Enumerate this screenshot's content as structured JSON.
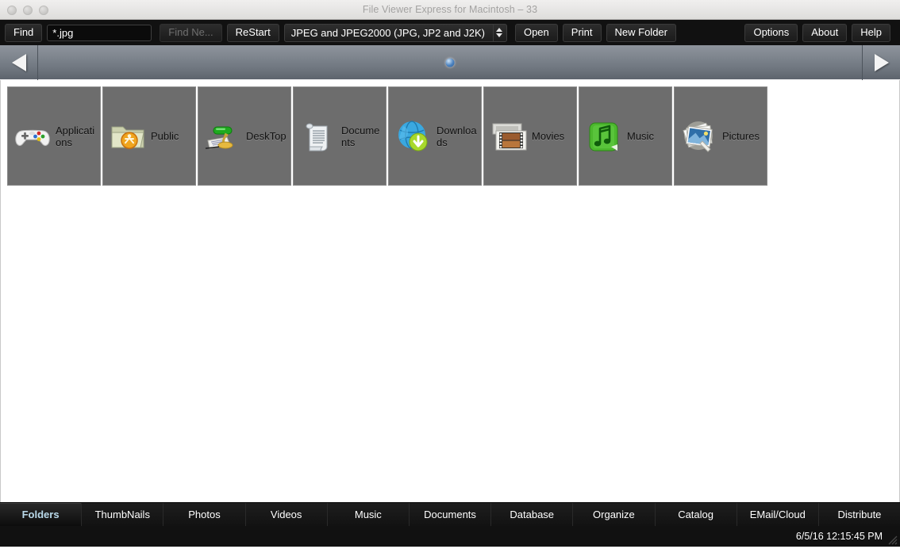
{
  "window": {
    "title": "File Viewer Express for Macintosh – 33",
    "traffic_lights": [
      "close",
      "minimize",
      "zoom"
    ]
  },
  "toolbar": {
    "find_label": "Find",
    "find_value": "*.jpg",
    "find_placeholder": "*.jpg",
    "find_next_label": "Find Ne...",
    "find_next_disabled": true,
    "restart_label": "ReStart",
    "filetype_selected": "JPEG and JPEG2000 (JPG, JP2 and J2K)",
    "filetype_options": [
      "JPEG and JPEG2000 (JPG, JP2 and J2K)"
    ],
    "open_label": "Open",
    "print_label": "Print",
    "new_folder_label": "New Folder",
    "options_label": "Options",
    "about_label": "About",
    "help_label": "Help"
  },
  "navbar": {
    "prev_icon": "left-triangle-icon",
    "next_icon": "right-triangle-icon",
    "page_marker": "page-position-dot"
  },
  "tiles": [
    {
      "label": "Applications",
      "icon": "game-controller-icon"
    },
    {
      "label": "Public",
      "icon": "public-folder-icon"
    },
    {
      "label": "DeskTop",
      "icon": "desk-lamp-icon"
    },
    {
      "label": "Documents",
      "icon": "scroll-document-icon"
    },
    {
      "label": "Downloads",
      "icon": "globe-download-icon"
    },
    {
      "label": "Movies",
      "icon": "film-strip-icon"
    },
    {
      "label": "Music",
      "icon": "music-note-icon"
    },
    {
      "label": "Pictures",
      "icon": "photos-icon"
    }
  ],
  "tabs": [
    {
      "label": "Folders",
      "active": true
    },
    {
      "label": "ThumbNails",
      "active": false
    },
    {
      "label": "Photos",
      "active": false
    },
    {
      "label": "Videos",
      "active": false
    },
    {
      "label": "Music",
      "active": false
    },
    {
      "label": "Documents",
      "active": false
    },
    {
      "label": "Database",
      "active": false
    },
    {
      "label": "Organize",
      "active": false
    },
    {
      "label": "Catalog",
      "active": false
    },
    {
      "label": "EMail/Cloud",
      "active": false
    },
    {
      "label": "Distribute",
      "active": false
    }
  ],
  "statusbar": {
    "timestamp": "6/5/16 12:15:45 PM",
    "resize_grip": "resize-grip-icon"
  },
  "colors": {
    "toolbar_bg": "#111111",
    "navbar_bg": "#7c838c",
    "tile_bg": "#6d6d6d",
    "tab_active_text": "#b9d9ea",
    "content_bg": "#ffffff"
  }
}
